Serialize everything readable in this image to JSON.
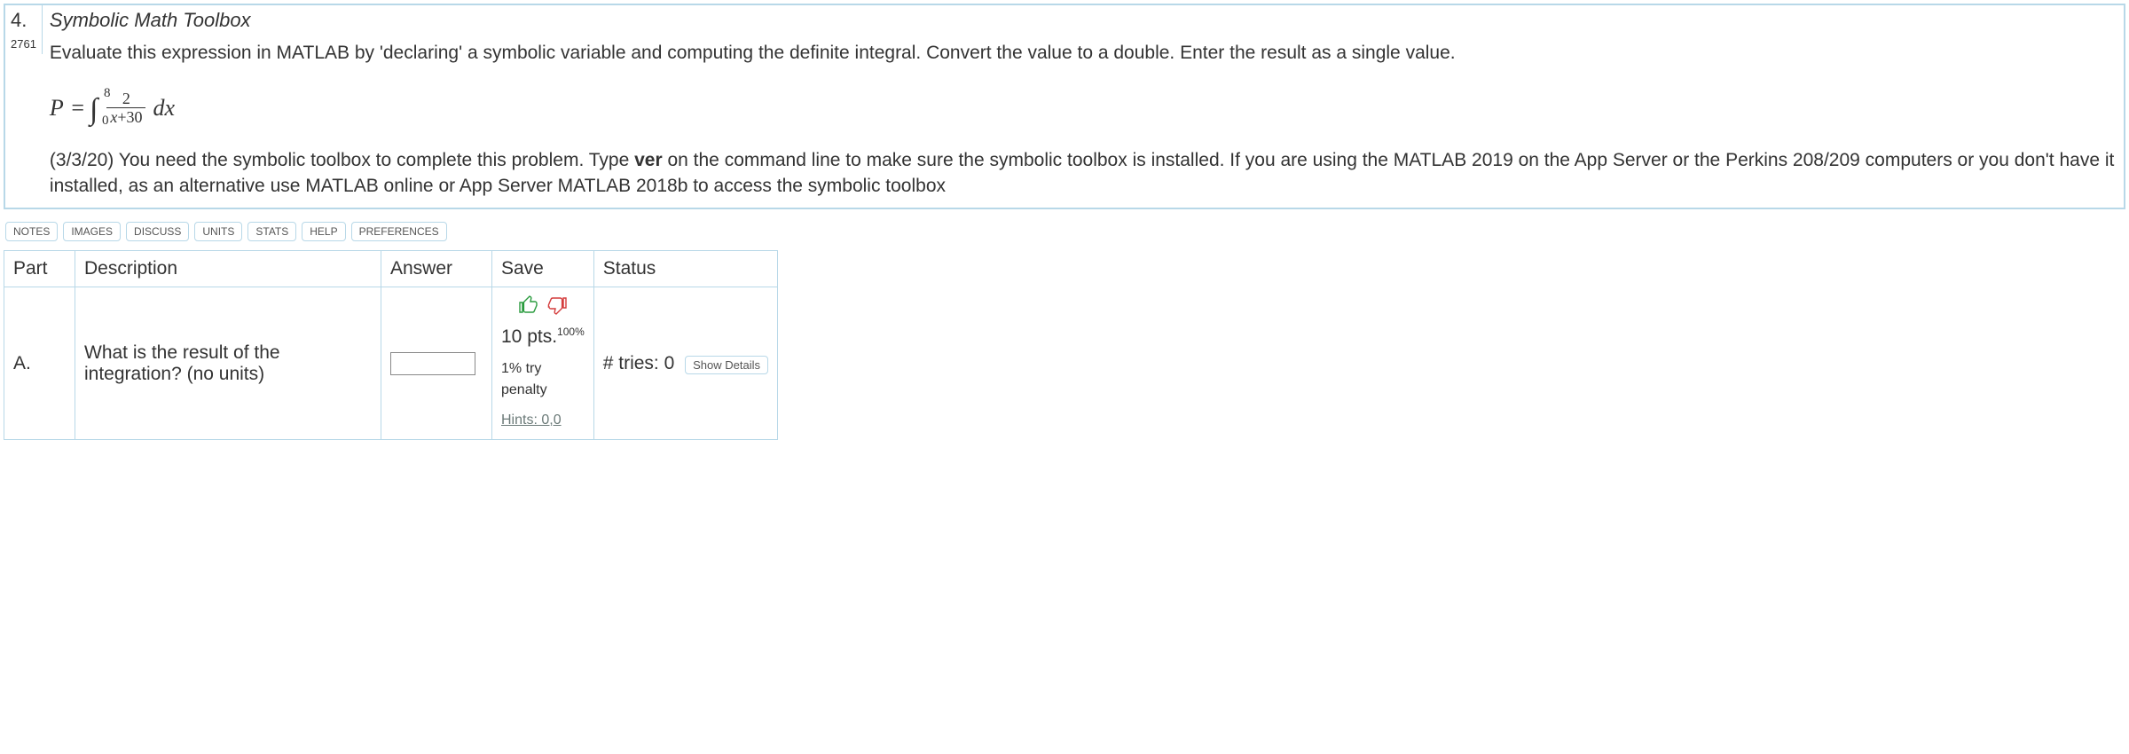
{
  "question": {
    "number": "4.",
    "id": "2761",
    "title": "Symbolic Math Toolbox",
    "prompt": "Evaluate this expression in MATLAB by 'declaring' a symbolic variable and computing the definite integral. Convert the value to a double. Enter the result as a single value.",
    "equation": {
      "lhs": "P",
      "lower": "0",
      "upper": "8",
      "numerator": "2",
      "denom_var": "x",
      "denom_plus": "+",
      "denom_const": "30",
      "dx": "dx"
    },
    "note_pre": "(3/3/20) You need the symbolic toolbox to complete this problem. Type ",
    "note_bold": "ver",
    "note_post": " on the command line to make sure the symbolic toolbox is installed. If you are using the MATLAB 2019 on the App Server or the Perkins 208/209 computers or you don't have it installed, as an alternative use MATLAB online or App Server MATLAB 2018b to access the symbolic toolbox"
  },
  "tabs": {
    "notes": "NOTES",
    "images": "IMAGES",
    "discuss": "DISCUSS",
    "units": "UNITS",
    "stats": "STATS",
    "help": "HELP",
    "preferences": "PREFERENCES"
  },
  "table": {
    "headers": {
      "part": "Part",
      "description": "Description",
      "answer": "Answer",
      "save": "Save",
      "status": "Status"
    },
    "row": {
      "part": "A.",
      "description": "What is the result of the integration? (no units)",
      "answer_value": "",
      "points_text": "10 pts.",
      "points_pct": "100%",
      "penalty": "1% try penalty",
      "hints": "Hints: 0,0",
      "tries_label": "# tries: 0",
      "details_btn": "Show Details"
    }
  }
}
